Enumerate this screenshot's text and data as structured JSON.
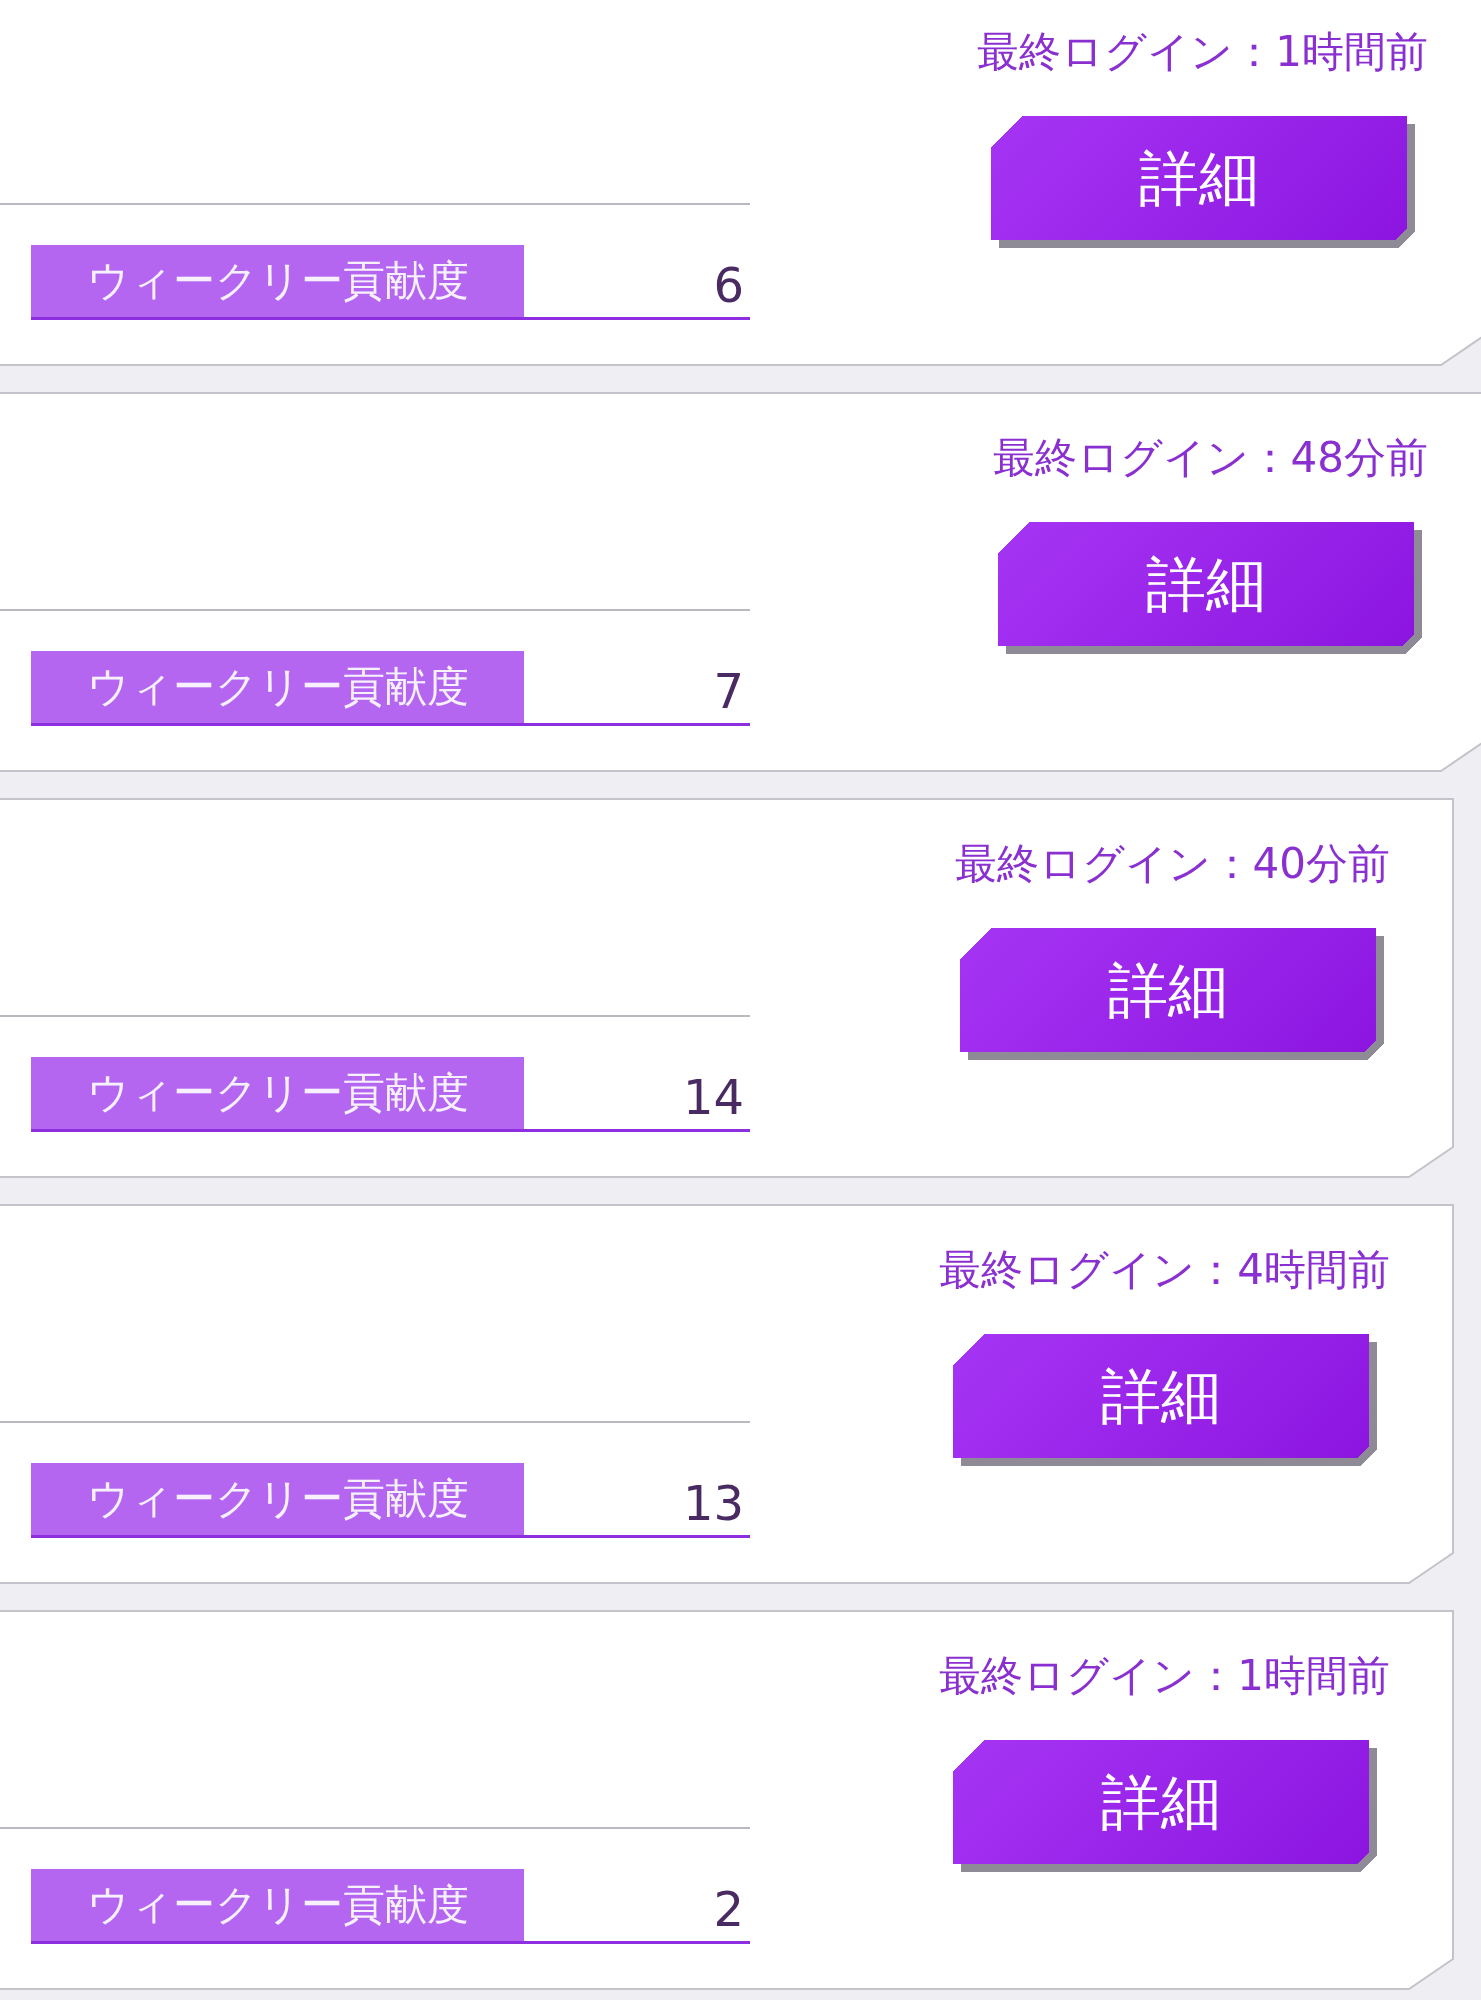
{
  "members": [
    {
      "last_login": "最終ログイン：1時間前",
      "detail_button": "詳細",
      "contribution_label": "ウィークリー貢献度",
      "contribution_value": "6"
    },
    {
      "last_login": "最終ログイン：48分前",
      "detail_button": "詳細",
      "contribution_label": "ウィークリー貢献度",
      "contribution_value": "7"
    },
    {
      "last_login": "最終ログイン：40分前",
      "detail_button": "詳細",
      "contribution_label": "ウィークリー貢献度",
      "contribution_value": "14"
    },
    {
      "last_login": "最終ログイン：4時間前",
      "detail_button": "詳細",
      "contribution_label": "ウィークリー貢献度",
      "contribution_value": "13"
    },
    {
      "last_login": "最終ログイン：1時間前",
      "detail_button": "詳細",
      "contribution_label": "ウィークリー貢献度",
      "contribution_value": "2"
    }
  ]
}
